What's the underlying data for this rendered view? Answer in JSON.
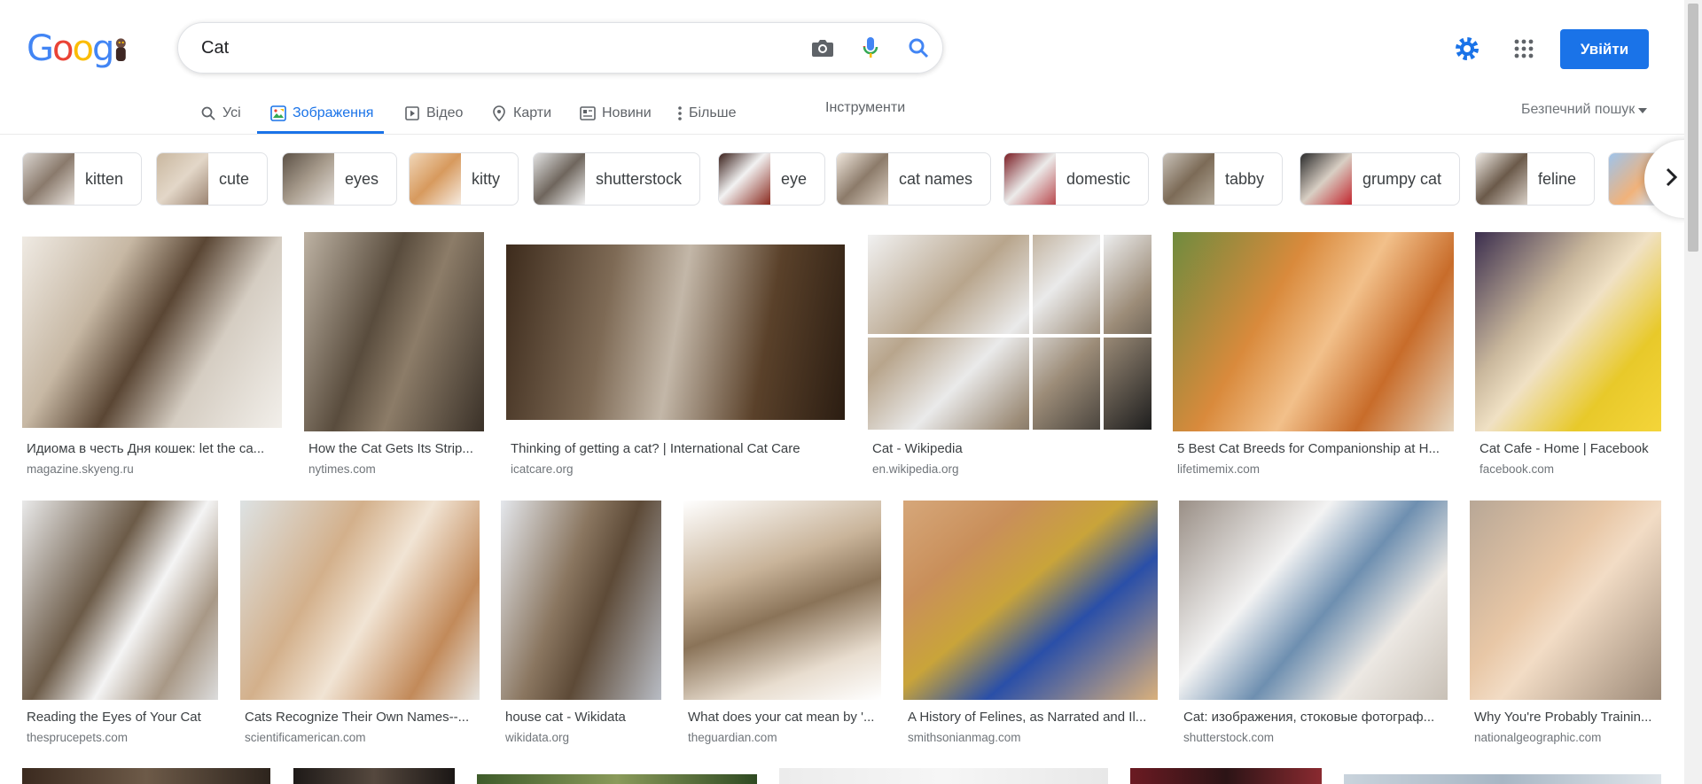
{
  "search": {
    "query": "Cat"
  },
  "header": {
    "signin_label": "Увійти"
  },
  "tabs": [
    {
      "label": "Усі",
      "icon": "search-icon"
    },
    {
      "label": "Зображення",
      "icon": "image-icon"
    },
    {
      "label": "Відео",
      "icon": "video-icon"
    },
    {
      "label": "Карти",
      "icon": "map-pin-icon"
    },
    {
      "label": "Новини",
      "icon": "news-icon"
    },
    {
      "label": "Більше",
      "icon": "more-vert-icon"
    }
  ],
  "tools_label": "Інструменти",
  "safe_search_label": "Безпечний пошук",
  "chips": [
    {
      "label": "kitten"
    },
    {
      "label": "cute"
    },
    {
      "label": "eyes"
    },
    {
      "label": "kitty"
    },
    {
      "label": "shutterstock"
    },
    {
      "label": "eye"
    },
    {
      "label": "cat names"
    },
    {
      "label": "domestic"
    },
    {
      "label": "tabby"
    },
    {
      "label": "grumpy cat"
    },
    {
      "label": "feline"
    }
  ],
  "results": [
    {
      "title": "Идиома в честь Дня кошек: let the ca...",
      "source": "magazine.skyeng.ru"
    },
    {
      "title": "How the Cat Gets Its Strip...",
      "source": "nytimes.com"
    },
    {
      "title": "Thinking of getting a cat? | International Cat Care",
      "source": "icatcare.org"
    },
    {
      "title": "Cat - Wikipedia",
      "source": "en.wikipedia.org"
    },
    {
      "title": "5 Best Cat Breeds for Companionship at H...",
      "source": "lifetimemix.com"
    },
    {
      "title": "Cat Cafe - Home | Facebook",
      "source": "facebook.com"
    },
    {
      "title": "Reading the Eyes of Your Cat",
      "source": "thesprucepets.com"
    },
    {
      "title": "Cats Recognize Their Own Names--...",
      "source": "scientificamerican.com"
    },
    {
      "title": "house cat - Wikidata",
      "source": "wikidata.org"
    },
    {
      "title": "What does your cat mean by '...",
      "source": "theguardian.com"
    },
    {
      "title": "A History of Felines, as Narrated and Il...",
      "source": "smithsonianmag.com"
    },
    {
      "title": "Cat: изображения, стоковые фотограф...",
      "source": "shutterstock.com"
    },
    {
      "title": "Why You're Probably Trainin...",
      "source": "nationalgeographic.com"
    }
  ]
}
